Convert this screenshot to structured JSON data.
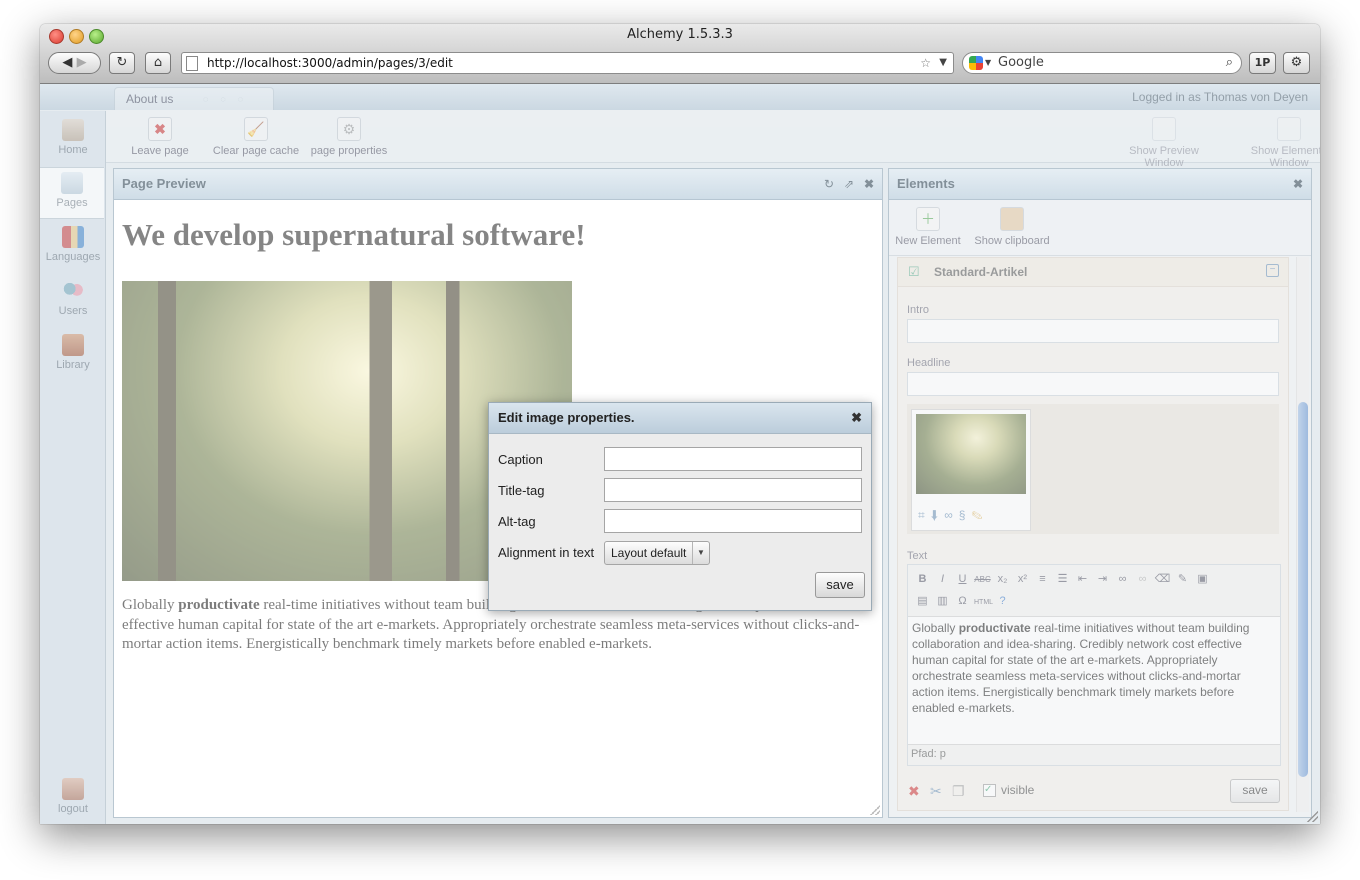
{
  "browser": {
    "title": "Alchemy 1.5.3.3",
    "url": "http://localhost:3000/admin/pages/3/edit",
    "search_placeholder": "Google",
    "onepassword_label": "1P"
  },
  "header": {
    "tab_label": "About us",
    "logged_in": "Logged in as Thomas von Deyen"
  },
  "sidebar": {
    "items": [
      {
        "label": "Home"
      },
      {
        "label": "Pages"
      },
      {
        "label": "Languages"
      },
      {
        "label": "Users"
      },
      {
        "label": "Library"
      }
    ],
    "logout_label": "logout"
  },
  "toolbar": {
    "leave_page": "Leave page",
    "clear_cache": "Clear page cache",
    "page_properties": "page properties",
    "show_preview": "Show Preview Window",
    "show_elements": "Show Elements Window"
  },
  "preview": {
    "title": "Page Preview",
    "headline": "We develop supernatural software!",
    "body_lead": "Globally ",
    "body_bold": "productivate",
    "body_rest": " real-time initiatives without team building collaboration and idea-sharing. Credibly network cost effective human capital for state of the art e-markets. Appropriately orchestrate seamless meta-services without clicks-and-mortar action items. Energistically benchmark timely markets before enabled e-markets."
  },
  "dialog": {
    "title": "Edit image properties.",
    "caption_label": "Caption",
    "title_tag_label": "Title-tag",
    "alt_tag_label": "Alt-tag",
    "alignment_label": "Alignment in text",
    "alignment_value": "Layout default",
    "save_label": "save"
  },
  "elements": {
    "title": "Elements",
    "new_element": "New Element",
    "show_clipboard": "Show clipboard",
    "element_name": "Standard-Artikel",
    "intro_label": "Intro",
    "headline_label": "Headline",
    "text_label": "Text",
    "text_lead": "Globally ",
    "text_bold": "productivate",
    "text_rest": " real-time initiatives without team building collaboration and idea-sharing. Credibly network cost effective human capital for state of the art e-markets. Appropriately orchestrate seamless meta-services without clicks-and-mortar action items. Energistically benchmark timely markets before enabled e-markets.",
    "path_label": "Pfad: p",
    "visible_label": "visible",
    "save_label": "save"
  }
}
